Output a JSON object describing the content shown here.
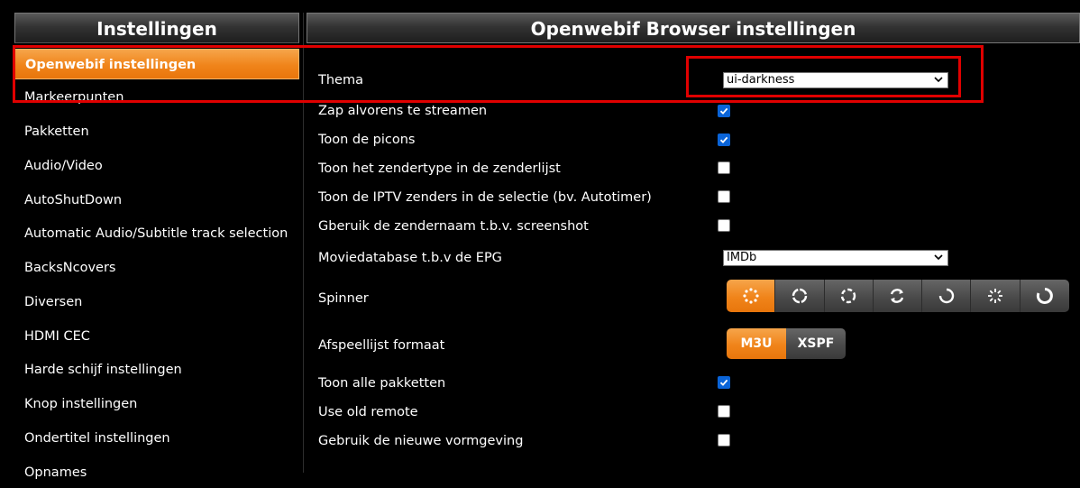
{
  "sidebar": {
    "title": "Instellingen",
    "items": [
      {
        "label": "Openwebif instellingen"
      },
      {
        "label": "Markeerpunten"
      },
      {
        "label": "Pakketten"
      },
      {
        "label": "Audio/Video"
      },
      {
        "label": "AutoShutDown"
      },
      {
        "label": "Automatic Audio/Subtitle track selection"
      },
      {
        "label": "BacksNcovers"
      },
      {
        "label": "Diversen"
      },
      {
        "label": "HDMI CEC"
      },
      {
        "label": "Harde schijf instellingen"
      },
      {
        "label": "Knop instellingen"
      },
      {
        "label": "Ondertitel instellingen"
      },
      {
        "label": "Opnames"
      }
    ]
  },
  "main": {
    "title": "Openwebif Browser instellingen",
    "theme": {
      "label": "Thema",
      "value": "ui-darkness"
    },
    "checkboxes": [
      {
        "label": "Zap alvorens te streamen",
        "checked": true
      },
      {
        "label": "Toon de picons",
        "checked": true
      },
      {
        "label": "Toon het zendertype in de zenderlijst",
        "checked": false
      },
      {
        "label": "Toon de IPTV zenders in de selectie (bv. Autotimer)",
        "checked": false
      },
      {
        "label": "Gberuik de zendernaam t.b.v. screenshot",
        "checked": false
      }
    ],
    "moviedb": {
      "label": "Moviedatabase t.b.v de EPG",
      "value": "IMDb"
    },
    "spinner": {
      "label": "Spinner",
      "options": [
        "spinner-dots-icon",
        "spinner-ring-icon",
        "spinner-dashed-ring-icon",
        "spinner-arrows-icon",
        "spinner-arc-icon",
        "spinner-ticks-icon",
        "spinner-thin-arc-icon"
      ],
      "selected_index": 0
    },
    "playlist": {
      "label": "Afspeellijst formaat",
      "options": [
        "M3U",
        "XSPF"
      ],
      "selected": "M3U"
    },
    "checkboxes2": [
      {
        "label": "Toon alle pakketten",
        "checked": true
      },
      {
        "label": "Use old remote",
        "checked": false
      },
      {
        "label": "Gebruik de nieuwe vormgeving",
        "checked": false
      }
    ]
  },
  "colors": {
    "accent": "#f0841a",
    "highlight": "#e00000",
    "checkbox": "#0a64d8"
  }
}
